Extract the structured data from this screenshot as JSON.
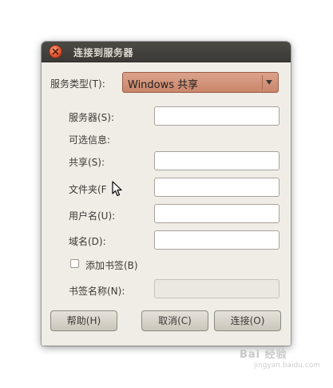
{
  "window": {
    "title": "连接到服务器"
  },
  "form": {
    "service_type_label": "服务类型(T):",
    "service_type_value": "Windows 共享",
    "server_label": "服务器(S):",
    "server_value": "",
    "optional_info_label": "可选信息:",
    "share_label": "共享(S):",
    "share_value": "",
    "folder_label": "文件夹(F",
    "folder_value": "",
    "username_label": "用户名(U):",
    "username_value": "",
    "domain_label": "域名(D):",
    "domain_value": "",
    "bookmark_checkbox_label": "添加书签(B)",
    "bookmark_checked": false,
    "bookmark_name_label": "书签名称(N):",
    "bookmark_name_value": ""
  },
  "buttons": {
    "help": "帮助(H)",
    "cancel": "取消(C)",
    "connect": "连接(O)"
  },
  "watermark": {
    "text": "Bai 经验",
    "sub": "jingyan.baidu.com"
  },
  "colors": {
    "titlebar": "#3c3b37",
    "window_bg": "#f0ece6",
    "combo_accent": "#d2957b",
    "close_button": "#e2562f"
  },
  "icons": {
    "close": "close-icon",
    "dropdown": "triangle-down-icon",
    "cursor": "mouse-pointer-icon"
  }
}
